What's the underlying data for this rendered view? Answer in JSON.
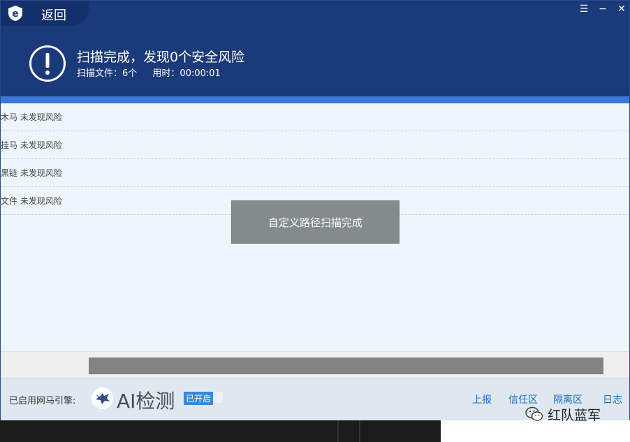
{
  "header": {
    "back_label": "返回",
    "title": "扫描完成，发现0个安全风险",
    "files_scanned": "扫描文件：6个",
    "elapsed": "用时：00:00:01"
  },
  "window_controls": {
    "menu": "☰",
    "minimize": "−",
    "close": "✕"
  },
  "results": [
    {
      "label": "木马 未发现风险"
    },
    {
      "label": "挂马 未发现风险"
    },
    {
      "label": "黑链 未发现风险"
    },
    {
      "label": "文件 未发现风险"
    }
  ],
  "toast": "自定义路径扫描完成",
  "progress": {
    "value_percent": 100
  },
  "footer": {
    "engine_label": "已启用网马引擎:",
    "ai_label": "AI检测",
    "enabled_tag": "已开启",
    "links": [
      "上报",
      "信任区",
      "隔离区",
      "日志"
    ]
  },
  "watermark": "红队蓝军",
  "colors": {
    "header": "#1b3a7a",
    "accent": "#3b76d8",
    "link": "#1f6fc5",
    "toast": "#858a8b"
  }
}
